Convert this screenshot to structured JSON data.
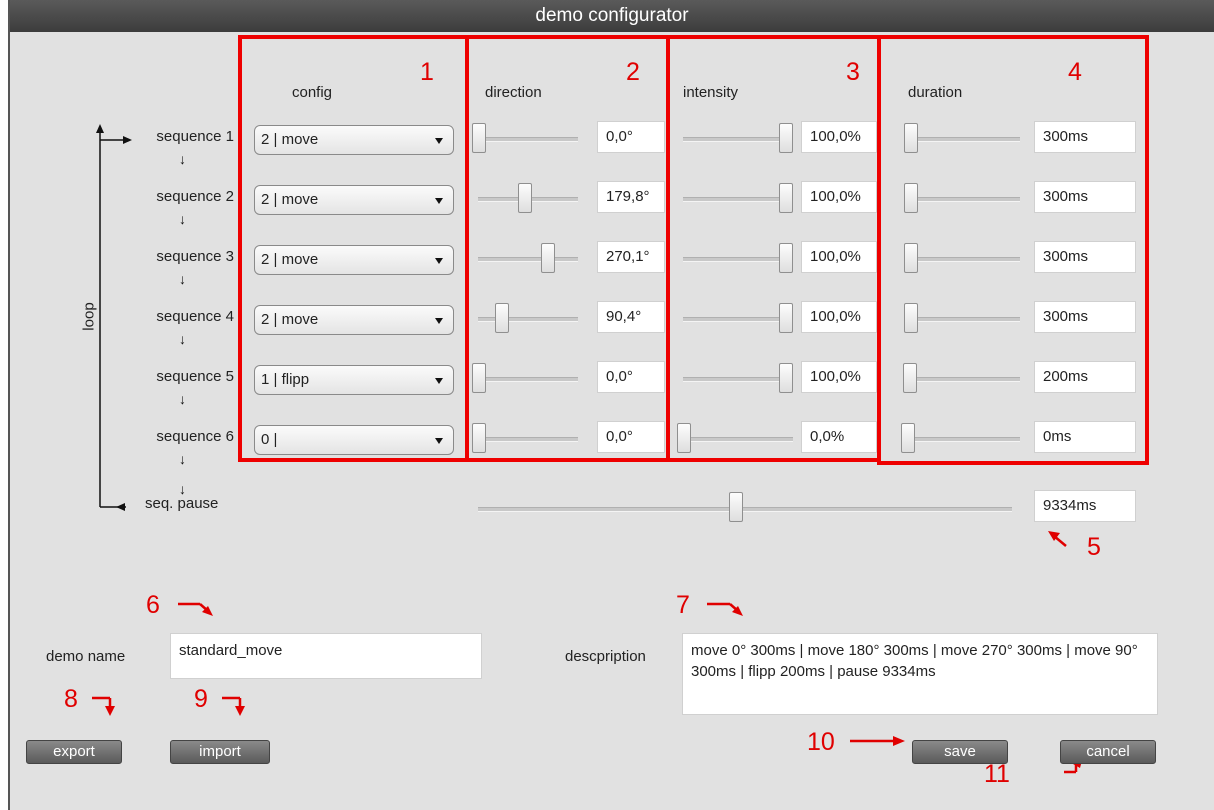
{
  "window": {
    "title": "demo configurator"
  },
  "headers": {
    "config": "config",
    "direction": "direction",
    "intensity": "intensity",
    "duration": "duration"
  },
  "sequences": [
    {
      "label": "sequence 1",
      "config": "2 | move",
      "direction": "0,0°",
      "direction_level": 0.0,
      "intensity": "100,0%",
      "intensity_level": 1.0,
      "duration": "300ms",
      "duration_level": 0.03
    },
    {
      "label": "sequence 2",
      "config": "2 | move",
      "direction": "179,8°",
      "direction_level": 0.5,
      "intensity": "100,0%",
      "intensity_level": 1.0,
      "duration": "300ms",
      "duration_level": 0.03
    },
    {
      "label": "sequence 3",
      "config": "2 | move",
      "direction": "270,1°",
      "direction_level": 0.75,
      "intensity": "100,0%",
      "intensity_level": 1.0,
      "duration": "300ms",
      "duration_level": 0.03
    },
    {
      "label": "sequence 4",
      "config": "2 | move",
      "direction": "90,4°",
      "direction_level": 0.25,
      "intensity": "100,0%",
      "intensity_level": 1.0,
      "duration": "300ms",
      "duration_level": 0.03
    },
    {
      "label": "sequence 5",
      "config": "1 | flipp",
      "direction": "0,0°",
      "direction_level": 0.0,
      "intensity": "100,0%",
      "intensity_level": 1.0,
      "duration": "200ms",
      "duration_level": 0.02
    },
    {
      "label": "sequence 6",
      "config": "0 |",
      "direction": "0,0°",
      "direction_level": 0.0,
      "intensity": "0,0%",
      "intensity_level": 0.0,
      "duration": "0ms",
      "duration_level": 0.0
    }
  ],
  "pause": {
    "label": "seq. pause",
    "value": "9334ms",
    "level": 0.47
  },
  "loop_label": "loop",
  "demo_name": {
    "label": "demo name",
    "value": "standard_move"
  },
  "description": {
    "label": "descpription",
    "value": "move 0° 300ms | move 180° 300ms | move 270° 300ms | move 90° 300ms | flipp 200ms | pause 9334ms"
  },
  "buttons": {
    "export": "export",
    "import": "import",
    "save": "save",
    "cancel": "cancel"
  },
  "annotations": [
    "1",
    "2",
    "3",
    "4",
    "5",
    "6",
    "7",
    "8",
    "9",
    "10",
    "11"
  ],
  "colors": {
    "annotation": "#ee0000",
    "titlebar": "#444444",
    "background": "#e1e1e1"
  }
}
